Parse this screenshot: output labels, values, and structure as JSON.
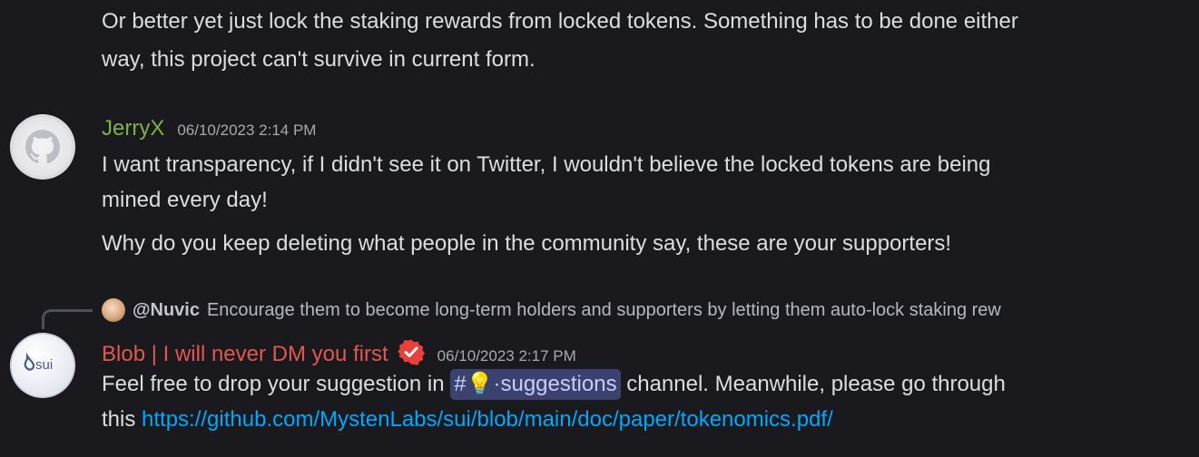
{
  "messages": {
    "continuation_1": {
      "line1": "Or better yet just lock the staking rewards from locked tokens. Something has to be done either",
      "line2": "way, this project can't survive in current form."
    },
    "jerry": {
      "username": "JerryX",
      "username_color": "#7fb244",
      "timestamp": "06/10/2023 2:14 PM",
      "avatar_icon": "github-octocat-icon",
      "line1": "I want transparency, if I didn't see it on Twitter, I wouldn't believe the locked tokens are being",
      "line2": "mined every day!",
      "line3": "Why do you keep deleting what people in the community say, these are your supporters!"
    },
    "blob": {
      "reply": {
        "user": "@Nuvic",
        "text": "Encourage them to become long-term holders and supporters by letting them auto-lock staking rew"
      },
      "username": "Blob | I will never DM you first",
      "username_color": "#e0584f",
      "verified_icon": "verified-check-icon",
      "verified_color": "#e8413b",
      "timestamp": "06/10/2023 2:17 PM",
      "avatar_label": "sui",
      "text_before_channel": "Feel free to drop your suggestion in ",
      "channel_hash": "#",
      "channel_emoji": "💡",
      "channel_name": "·suggestions",
      "text_after_channel": " channel. Meanwhile, please go through",
      "line2_prefix": "this ",
      "link": "https://github.com/MystenLabs/sui/blob/main/doc/paper/tokenomics.pdf/"
    }
  }
}
